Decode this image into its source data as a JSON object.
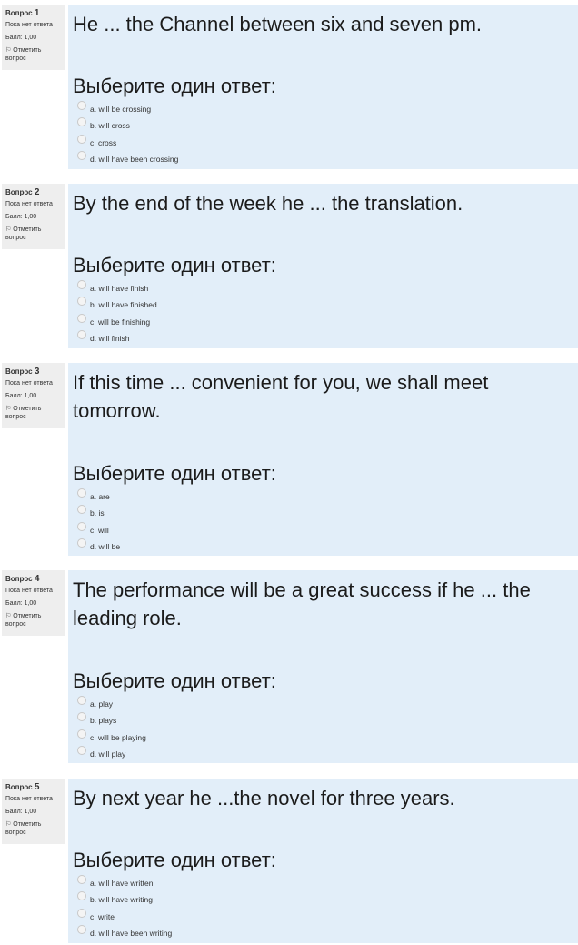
{
  "questions": [
    {
      "label": "Вопрос",
      "number": "1",
      "state": "Пока нет ответа",
      "grade": "Балл: 1,00",
      "flag_label": "Отметить вопрос",
      "text": "He ... the Channel between six and seven pm.",
      "prompt": "Выберите один ответ:",
      "answers": [
        "a. will be crossing",
        "b. will cross",
        "c. cross",
        "d. will have been crossing"
      ]
    },
    {
      "label": "Вопрос",
      "number": "2",
      "state": "Пока нет ответа",
      "grade": "Балл: 1,00",
      "flag_label": "Отметить вопрос",
      "text": "By the end of the week he ... the translation.",
      "prompt": "Выберите один ответ:",
      "answers": [
        "a. will have finish",
        "b. will have finished",
        "c. will be finishing",
        "d. will finish"
      ]
    },
    {
      "label": "Вопрос",
      "number": "3",
      "state": "Пока нет ответа",
      "grade": "Балл: 1,00",
      "flag_label": "Отметить вопрос",
      "text": "If this time ... convenient for you, we shall meet tomorrow.",
      "prompt": "Выберите один ответ:",
      "answers": [
        "a. are",
        "b. is",
        "c. will",
        "d. will be"
      ]
    },
    {
      "label": "Вопрос",
      "number": "4",
      "state": "Пока нет ответа",
      "grade": "Балл: 1,00",
      "flag_label": "Отметить вопрос",
      "text": "The performance will be a great success if he ... the leading role.",
      "prompt": "Выберите один ответ:",
      "answers": [
        "a. play",
        "b. plays",
        "c. will be playing",
        "d. will play"
      ]
    },
    {
      "label": "Вопрос",
      "number": "5",
      "state": "Пока нет ответа",
      "grade": "Балл: 1,00",
      "flag_label": "Отметить вопрос",
      "text": "By next year he ...the novel for three years.",
      "prompt": "Выберите один ответ:",
      "answers": [
        "a. will have written",
        "b. will have writing",
        "c. write",
        "d. will have been writing"
      ]
    }
  ]
}
